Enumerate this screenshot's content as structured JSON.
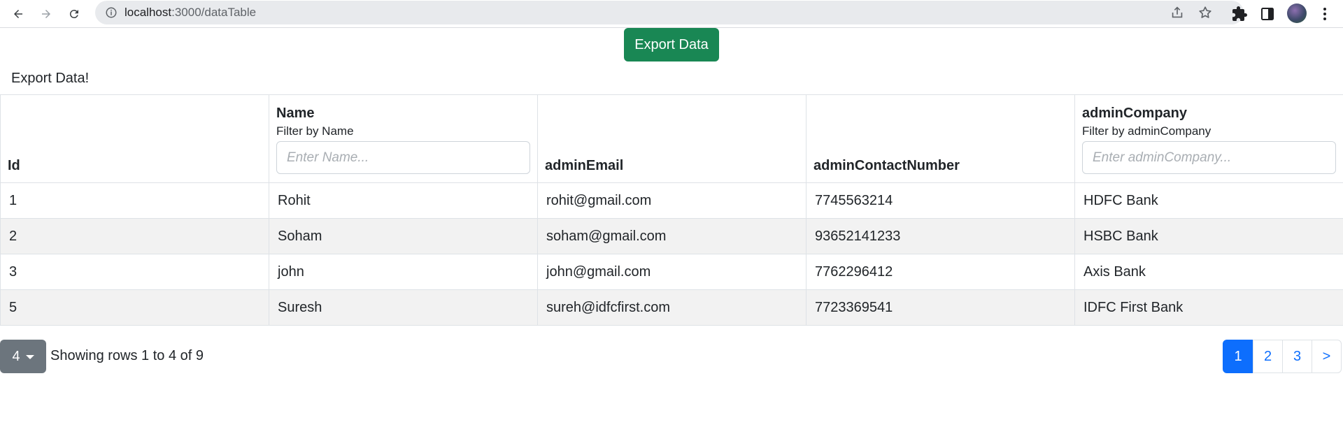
{
  "browser": {
    "url_host": "localhost",
    "url_path": ":3000/dataTable"
  },
  "page": {
    "export_button": "Export Data",
    "export_title": "Export Data!"
  },
  "table": {
    "columns": {
      "id": "Id",
      "name": "Name",
      "email": "adminEmail",
      "contact": "adminContactNumber",
      "company": "adminCompany"
    },
    "filters": {
      "name_label": "Filter by Name",
      "name_placeholder": "Enter Name...",
      "company_label": "Filter by adminCompany",
      "company_placeholder": "Enter adminCompany..."
    },
    "rows": [
      {
        "id": "1",
        "name": "Rohit",
        "email": "rohit@gmail.com",
        "contact": "7745563214",
        "company": "HDFC Bank"
      },
      {
        "id": "2",
        "name": "Soham",
        "email": "soham@gmail.com",
        "contact": "93652141233",
        "company": "HSBC Bank"
      },
      {
        "id": "3",
        "name": "john",
        "email": "john@gmail.com",
        "contact": "7762296412",
        "company": "Axis Bank"
      },
      {
        "id": "5",
        "name": "Suresh",
        "email": "sureh@idfcfirst.com",
        "contact": "7723369541",
        "company": "IDFC First Bank"
      }
    ]
  },
  "pager": {
    "page_size": "4",
    "showing_text": "Showing rows 1 to 4 of 9",
    "pages": [
      "1",
      "2",
      "3"
    ],
    "next": ">",
    "active_page": "1"
  },
  "colors": {
    "export_green": "#198754",
    "active_blue": "#0d6efd",
    "size_gray": "#6c757d"
  }
}
